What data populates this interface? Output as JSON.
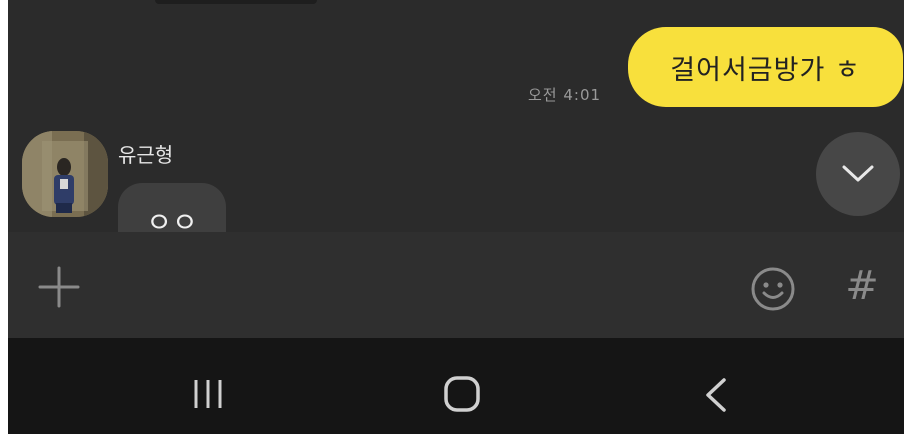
{
  "conversation": {
    "outgoing_message": {
      "text": "걸어서금방가 ㅎ",
      "time": "오전 4:01"
    },
    "incoming_message": {
      "sender": "유근형",
      "text": "ㅇㅇ"
    }
  },
  "controls": {
    "scroll_down_icon": "chevron-down-icon",
    "plus_icon": "plus-icon",
    "emoji_icon": "smiley-icon",
    "hash_label": "#"
  },
  "system_nav": {
    "recents_icon": "recent-apps-icon",
    "home_icon": "home-icon",
    "back_icon": "back-icon"
  },
  "colors": {
    "background": "#2b2b2b",
    "my_bubble": "#f8e03c",
    "other_bubble": "#3f3f3f",
    "nav_bar": "#151515"
  }
}
